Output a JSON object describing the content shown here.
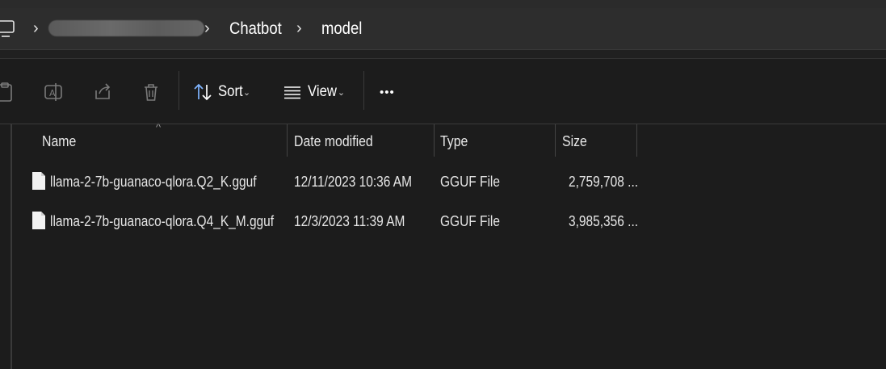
{
  "breadcrumb": {
    "redacted_segment": "",
    "segments": [
      "Chatbot",
      "model"
    ]
  },
  "toolbar": {
    "sort_label": "Sort",
    "view_label": "View",
    "more_label": "•••"
  },
  "columns": {
    "name": "Name",
    "date_modified": "Date modified",
    "type": "Type",
    "size": "Size"
  },
  "files": [
    {
      "name": "llama-2-7b-guanaco-qlora.Q2_K.gguf",
      "date_modified": "12/11/2023 10:36 AM",
      "type": "GGUF File",
      "size": "2,759,708 ..."
    },
    {
      "name": "llama-2-7b-guanaco-qlora.Q4_K_M.gguf",
      "date_modified": "12/3/2023 11:39 AM",
      "type": "GGUF File",
      "size": "3,985,356 ..."
    }
  ],
  "colors": {
    "background": "#1c1c1c",
    "address_bar": "#2d2d2d",
    "text": "#ffffff",
    "accent_icon": "#7fb4ff"
  }
}
